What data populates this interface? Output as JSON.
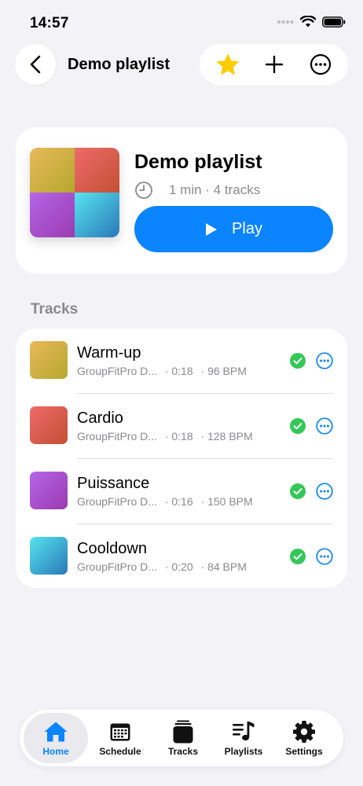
{
  "status": {
    "time": "14:57"
  },
  "nav": {
    "title": "Demo playlist"
  },
  "playlist": {
    "title": "Demo playlist",
    "meta": "1 min · 4 tracks",
    "play_label": "Play"
  },
  "section": {
    "tracks_title": "Tracks"
  },
  "tracks": [
    {
      "name": "Warm-up",
      "artist": "GroupFitPro D...",
      "duration": "· 0:18",
      "bpm": "· 96 BPM",
      "colors": [
        "#e8b85a",
        "#b5a82e"
      ]
    },
    {
      "name": "Cardio",
      "artist": "GroupFitPro D...",
      "duration": "· 0:18",
      "bpm": "· 128 BPM",
      "colors": [
        "#ee6b6b",
        "#c35033"
      ]
    },
    {
      "name": "Puissance",
      "artist": "GroupFitPro D...",
      "duration": "· 0:16",
      "bpm": "· 150 BPM",
      "colors": [
        "#b566e8",
        "#9b3bb0"
      ]
    },
    {
      "name": "Cooldown",
      "artist": "GroupFitPro D...",
      "duration": "· 0:20",
      "bpm": "· 84 BPM",
      "colors": [
        "#56e4ef",
        "#2a78b8"
      ]
    }
  ],
  "tabs": [
    {
      "label": "Home",
      "icon": "house-icon",
      "active": true
    },
    {
      "label": "Schedule",
      "icon": "calendar-icon",
      "active": false
    },
    {
      "label": "Tracks",
      "icon": "tracks-stack-icon",
      "active": false
    },
    {
      "label": "Playlists",
      "icon": "playlist-icon",
      "active": false
    },
    {
      "label": "Settings",
      "icon": "gear-icon",
      "active": false
    }
  ],
  "colors": {
    "accent": "#0a84ff",
    "success": "#34c759",
    "star": "#ffcc00"
  }
}
